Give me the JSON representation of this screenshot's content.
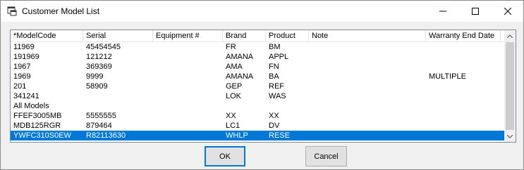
{
  "window": {
    "title": "Customer Model List"
  },
  "titlebar_buttons": {
    "minimize": "—",
    "maximize": "☐",
    "close": "✕"
  },
  "columns": [
    "*ModelCode",
    "Serial",
    "Equipment #",
    "Brand",
    "Product",
    "Note",
    "Warranty End Date"
  ],
  "rows": [
    {
      "model": "11969",
      "serial": "45454545",
      "equipment": "",
      "brand": "FR",
      "product": "BM",
      "note": "",
      "warranty": ""
    },
    {
      "model": "191969",
      "serial": "121212",
      "equipment": "",
      "brand": "AMANA",
      "product": "APPL",
      "note": "",
      "warranty": ""
    },
    {
      "model": "1967",
      "serial": "369369",
      "equipment": "",
      "brand": "AMA",
      "product": "FN",
      "note": "",
      "warranty": ""
    },
    {
      "model": "1969",
      "serial": "9999",
      "equipment": "",
      "brand": "AMANA",
      "product": "BA",
      "note": "",
      "warranty": "MULTIPLE"
    },
    {
      "model": "201",
      "serial": "58909",
      "equipment": "",
      "brand": "GEP",
      "product": "REF",
      "note": "",
      "warranty": ""
    },
    {
      "model": "341241",
      "serial": "",
      "equipment": "",
      "brand": "LOK",
      "product": "WAS",
      "note": "",
      "warranty": ""
    },
    {
      "model": "All Models",
      "serial": "",
      "equipment": "",
      "brand": "",
      "product": "",
      "note": "",
      "warranty": ""
    },
    {
      "model": "FFEF3005MB",
      "serial": "5555555",
      "equipment": "",
      "brand": "XX",
      "product": "XX",
      "note": "",
      "warranty": ""
    },
    {
      "model": "MDB125RGR",
      "serial": "879464",
      "equipment": "",
      "brand": "LC1",
      "product": "DV",
      "note": "",
      "warranty": ""
    },
    {
      "model": "YWFC310S0EW",
      "serial": "R82113630",
      "equipment": "",
      "brand": "WHLP",
      "product": "RESE",
      "note": "",
      "warranty": "",
      "selected": true
    }
  ],
  "buttons": {
    "ok": "OK",
    "cancel": "Cancel"
  },
  "colors": {
    "selection": "#0078d7",
    "window_bg": "#f0f0f0"
  }
}
